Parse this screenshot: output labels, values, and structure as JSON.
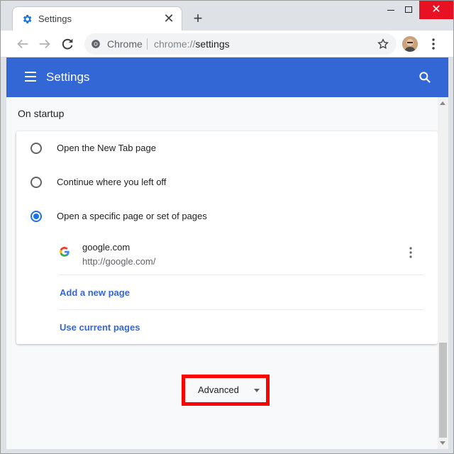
{
  "tab": {
    "title": "Settings"
  },
  "window_controls": {
    "minimize": "",
    "maximize": "",
    "close": "✕"
  },
  "toolbar": {
    "site_label": "Chrome",
    "url_scheme": "chrome://",
    "url_path": "settings"
  },
  "header": {
    "title": "Settings"
  },
  "startup": {
    "section_title": "On startup",
    "options": [
      {
        "label": "Open the New Tab page",
        "checked": false
      },
      {
        "label": "Continue where you left off",
        "checked": false
      },
      {
        "label": "Open a specific page or set of pages",
        "checked": true
      }
    ],
    "pages": [
      {
        "name": "google.com",
        "url": "http://google.com/"
      }
    ],
    "add_page_link": "Add a new page",
    "use_current_link": "Use current pages"
  },
  "advanced": {
    "label": "Advanced"
  },
  "colors": {
    "header_bg": "#3367d6",
    "accent": "#1a73e8",
    "link": "#3367d6",
    "highlight_box": "#ff0000",
    "close_button": "#e81123"
  }
}
